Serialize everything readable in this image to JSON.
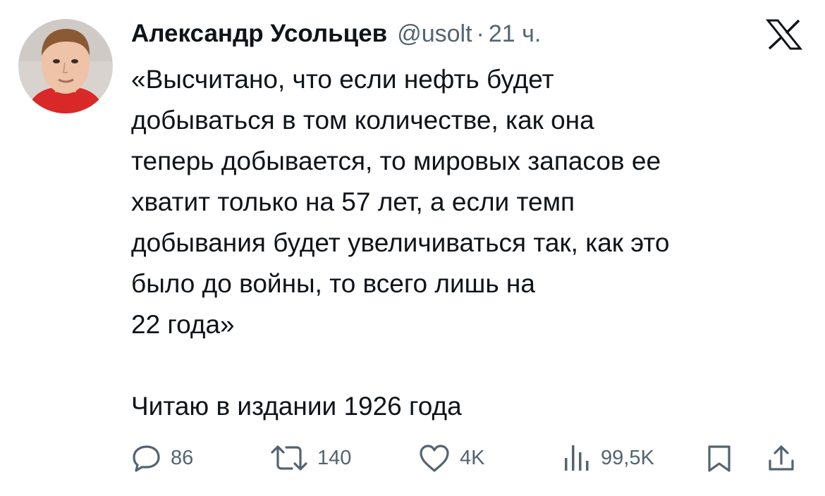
{
  "author": {
    "name": "Александр Усольцев",
    "handle": "@usolt",
    "separator": "·",
    "time": "21 ч."
  },
  "platform_logo": "x-logo-icon",
  "tweet": {
    "lines": [
      "«Высчитано, что если нефть будет",
      "добываться в том количестве, как она",
      "теперь добывается, то мировых запасов ее",
      "хватит только на 57 лет, а если темп",
      "добывания будет увеличиваться так, как это",
      "было до войны, то всего лишь на",
      "22 года»",
      "",
      "Читаю в издании 1926 года"
    ]
  },
  "actions": {
    "replies": "86",
    "reposts": "140",
    "likes": "4K",
    "views": "99,5K"
  },
  "colors": {
    "text": "#0f1419",
    "secondary": "#536471",
    "background": "#ffffff"
  }
}
